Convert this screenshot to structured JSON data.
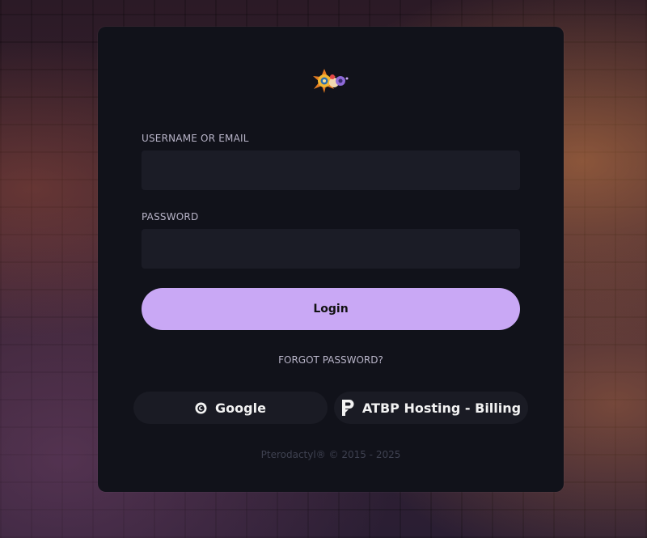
{
  "login_form": {
    "username_label": "USERNAME OR EMAIL",
    "username_value": "",
    "password_label": "PASSWORD",
    "password_value": "",
    "login_button": "Login",
    "forgot_password": "FORGOT PASSWORD?"
  },
  "oauth": {
    "google_label": "Google",
    "google_icon": "google-icon",
    "billing_label": "ATBP Hosting - Billing",
    "billing_icon": "paymenter-icon"
  },
  "footer": {
    "copyright": "Pterodactyl® © 2015 - 2025"
  },
  "colors": {
    "card": "#11121a",
    "input": "#1b1c26",
    "accent": "#c9a8f5"
  }
}
